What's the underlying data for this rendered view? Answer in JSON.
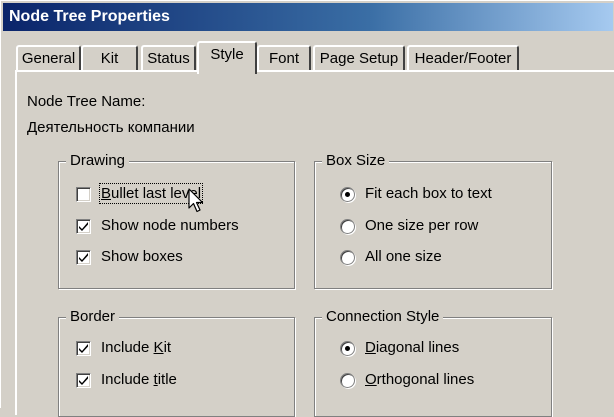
{
  "window": {
    "title": "Node Tree Properties"
  },
  "tabs": [
    {
      "label": "General",
      "active": false
    },
    {
      "label": "Kit",
      "active": false
    },
    {
      "label": "Status",
      "active": false
    },
    {
      "label": "Style",
      "active": true
    },
    {
      "label": "Font",
      "active": false
    },
    {
      "label": "Page Setup",
      "active": false
    },
    {
      "label": "Header/Footer",
      "active": false
    }
  ],
  "node_tree_name": {
    "label": "Node Tree Name:",
    "value": "Деятельность компании"
  },
  "drawing": {
    "title": "Drawing",
    "options": [
      {
        "label": "Bullet last level",
        "underline": "B",
        "rest": "ullet last level",
        "checked": false,
        "focused": true
      },
      {
        "label": "Show node numbers",
        "underline": "",
        "rest": "Show node numbers",
        "checked": true,
        "focused": false
      },
      {
        "label": "Show boxes",
        "underline": "",
        "rest": "Show boxes",
        "checked": true,
        "focused": false
      }
    ]
  },
  "box_size": {
    "title": "Box Size",
    "options": [
      {
        "label": "Fit each box to text",
        "selected": true
      },
      {
        "label": "One size per row",
        "selected": false
      },
      {
        "label": "All one size",
        "selected": false
      }
    ]
  },
  "border": {
    "title": "Border",
    "options": [
      {
        "label": "Include Kit",
        "pre": "Include ",
        "underline": "K",
        "post": "it",
        "checked": true
      },
      {
        "label": "Include title",
        "pre": "Include ",
        "underline": "t",
        "post": "itle",
        "checked": true
      }
    ]
  },
  "connection_style": {
    "title": "Connection Style",
    "options": [
      {
        "label": "Diagonal lines",
        "pre": "",
        "underline": "D",
        "post": "iagonal lines",
        "selected": true
      },
      {
        "label": "Orthogonal lines",
        "pre": "",
        "underline": "O",
        "post": "rthogonal lines",
        "selected": false
      }
    ]
  },
  "colors": {
    "face": "#d4d0c8",
    "titlebar_start": "#0a246a",
    "titlebar_end": "#a6caf0",
    "title_text": "#ffffff"
  },
  "icons": {
    "checkmark": "check-mark-icon",
    "radio_dot": "radio-dot-icon",
    "cursor": "mouse-pointer-icon"
  }
}
